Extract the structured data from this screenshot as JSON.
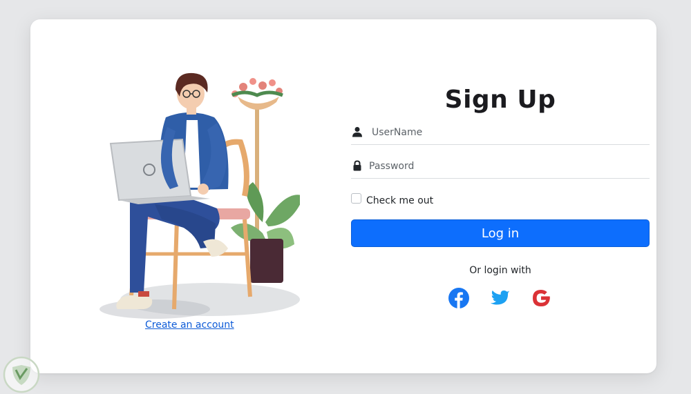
{
  "form": {
    "title": "Sign Up",
    "username_placeholder": "UserName",
    "password_placeholder": "Password",
    "checkbox_label": "Check me out",
    "checkbox_checked": false,
    "login_label": "Log in",
    "or_text": "Or login with"
  },
  "illustration": {
    "create_account_label": "Create an account"
  },
  "social": [
    {
      "name": "facebook",
      "icon": "facebook-icon",
      "color": "#1877f2"
    },
    {
      "name": "twitter",
      "icon": "twitter-icon",
      "color": "#1da1f2"
    },
    {
      "name": "google",
      "icon": "google-icon",
      "color": "#db3236"
    }
  ],
  "colors": {
    "primary": "#0d6efd",
    "link": "#0d5bd7",
    "page_background": "#e6e7e9",
    "card_background": "#ffffff"
  }
}
